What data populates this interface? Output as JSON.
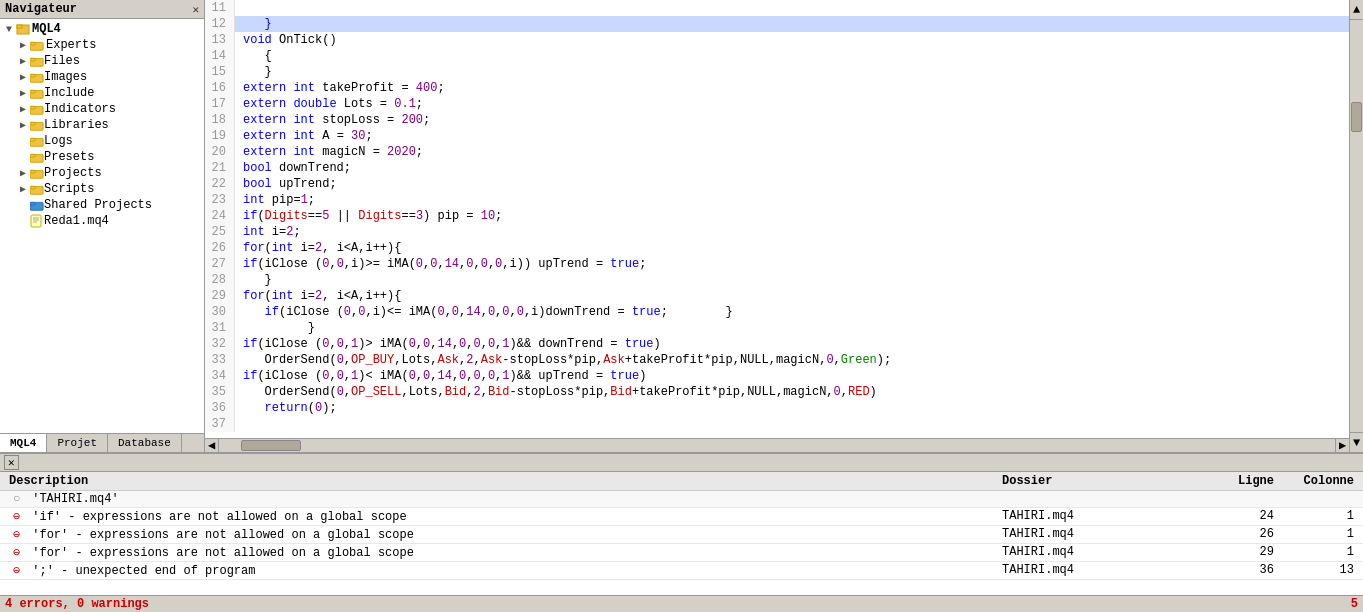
{
  "navigator": {
    "title": "Navigateur",
    "tree": [
      {
        "id": "mql4",
        "label": "MQL4",
        "type": "root",
        "expanded": true,
        "indent": 0
      },
      {
        "id": "experts",
        "label": "Experts",
        "type": "folder",
        "indent": 1
      },
      {
        "id": "files",
        "label": "Files",
        "type": "folder",
        "indent": 1
      },
      {
        "id": "images",
        "label": "Images",
        "type": "folder",
        "indent": 1
      },
      {
        "id": "include",
        "label": "Include",
        "type": "folder",
        "indent": 1
      },
      {
        "id": "indicators",
        "label": "Indicators",
        "type": "folder",
        "indent": 1
      },
      {
        "id": "libraries",
        "label": "Libraries",
        "type": "folder",
        "indent": 1
      },
      {
        "id": "logs",
        "label": "Logs",
        "type": "folder",
        "indent": 1
      },
      {
        "id": "presets",
        "label": "Presets",
        "type": "folder",
        "indent": 1
      },
      {
        "id": "projects",
        "label": "Projects",
        "type": "folder",
        "indent": 1
      },
      {
        "id": "scripts",
        "label": "Scripts",
        "type": "folder",
        "indent": 1
      },
      {
        "id": "shared",
        "label": "Shared Projects",
        "type": "shared",
        "indent": 1
      },
      {
        "id": "reda",
        "label": "Reda1.mq4",
        "type": "file",
        "indent": 1
      }
    ],
    "tabs": [
      {
        "id": "mql4",
        "label": "MQL4",
        "active": true
      },
      {
        "id": "projet",
        "label": "Projet",
        "active": false
      },
      {
        "id": "database",
        "label": "Database",
        "active": false
      }
    ]
  },
  "editor": {
    "lines": [
      {
        "num": 11,
        "code": ""
      },
      {
        "num": 12,
        "code": "   }",
        "highlight": true
      },
      {
        "num": 13,
        "code": "void OnTick()",
        "kw": "void"
      },
      {
        "num": 14,
        "code": "   {"
      },
      {
        "num": 15,
        "code": "   }"
      },
      {
        "num": 16,
        "code": "extern int takeProfit = 400;"
      },
      {
        "num": 17,
        "code": "extern double Lots = 0.1;"
      },
      {
        "num": 18,
        "code": "extern int stopLoss = 200;"
      },
      {
        "num": 19,
        "code": "extern int A = 30;"
      },
      {
        "num": 20,
        "code": "extern int magicN = 2020;"
      },
      {
        "num": 21,
        "code": "bool downTrend;"
      },
      {
        "num": 22,
        "code": "bool upTrend;"
      },
      {
        "num": 23,
        "code": "int pip=1;"
      },
      {
        "num": 24,
        "code": "if(Digits==5 || Digits==3) pip = 10;"
      },
      {
        "num": 25,
        "code": "int i=2;"
      },
      {
        "num": 26,
        "code": "for(int i=2, i<A,i++){"
      },
      {
        "num": 27,
        "code": "if(iClose (0,0,i)>= iMA(0,0,14,0,0,0,i)) upTrend = true;"
      },
      {
        "num": 28,
        "code": "   }"
      },
      {
        "num": 29,
        "code": "for(int i=2, i<A,i++){"
      },
      {
        "num": 30,
        "code": "   if(iClose (0,0,i)<= iMA(0,0,14,0,0,0,i)downTrend = true;"
      },
      {
        "num": 31,
        "code": "         }"
      },
      {
        "num": 32,
        "code": "if(iClose (0,0,1)> iMA(0,0,14,0,0,0,1)&& downTrend = true)"
      },
      {
        "num": 33,
        "code": "   OrderSend(0,OP_BUY,Lots,Ask,2,Ask-stopLoss*pip,Ask+takeProfit*pip,NULL,magicN,0,Green);"
      },
      {
        "num": 34,
        "code": "if(iClose (0,0,1)< iMA(0,0,14,0,0,0,1)&& upTrend = true)"
      },
      {
        "num": 35,
        "code": "   OrderSend(0,OP_SELL,Lots,Bid,2,Bid-stopLoss*pip,Bid+takeProfit*pip,NULL,magicN,0,RED)"
      },
      {
        "num": 36,
        "code": "   return(0);"
      },
      {
        "num": 37,
        "code": ""
      }
    ]
  },
  "errors": {
    "header": {
      "description": "Description",
      "dossier": "Dossier",
      "ligne": "Ligne",
      "colonne": "Colonne"
    },
    "rows": [
      {
        "type": "filename",
        "desc": "'TAHIRI.mq4'",
        "dossier": "",
        "ligne": "",
        "colonne": ""
      },
      {
        "type": "error",
        "desc": "'if' - expressions are not allowed on a global scope",
        "dossier": "TAHIRI.mq4",
        "ligne": "24",
        "colonne": "1"
      },
      {
        "type": "error",
        "desc": "'for' - expressions are not allowed on a global scope",
        "dossier": "TAHIRI.mq4",
        "ligne": "26",
        "colonne": "1"
      },
      {
        "type": "error",
        "desc": "'for' - expressions are not allowed on a global scope",
        "dossier": "TAHIRI.mq4",
        "ligne": "29",
        "colonne": "1"
      },
      {
        "type": "error",
        "desc": "';' - unexpected end of program",
        "dossier": "TAHIRI.mq4",
        "ligne": "36",
        "colonne": "13"
      }
    ],
    "status": "4 errors, 0 warnings",
    "error_count": "5"
  }
}
